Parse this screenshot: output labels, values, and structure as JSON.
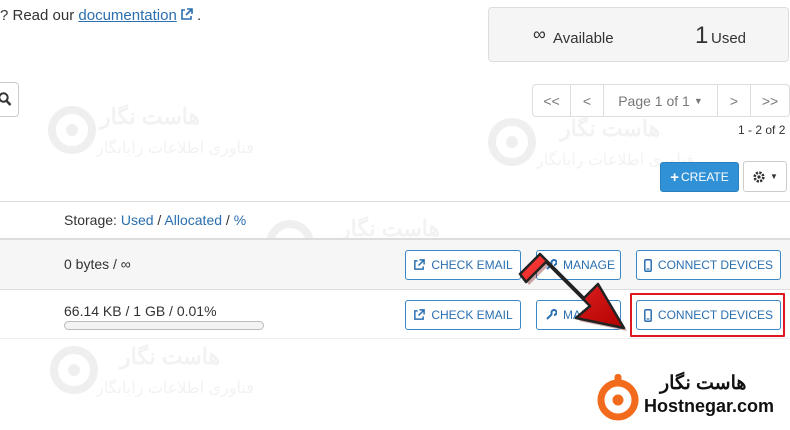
{
  "help": {
    "prefix": "? Read our ",
    "link": "documentation",
    "suffix": " ."
  },
  "stats": {
    "available_symbol": "∞",
    "available_label": "Available",
    "used_count": "1",
    "used_label": "Used"
  },
  "pagination": {
    "first": "<<",
    "prev": "<",
    "page_label": "Page 1 of 1",
    "next": ">",
    "last": ">>",
    "range": "1 - 2 of 2"
  },
  "toolbar": {
    "create_label": "CREATE"
  },
  "table": {
    "storage_label": "Storage: ",
    "used": "Used",
    "sep1": " / ",
    "allocated": "Allocated",
    "sep2": " / ",
    "percent": "%"
  },
  "rows": [
    {
      "usage": "0 bytes / ∞",
      "check_email": "CHECK EMAIL",
      "manage": "MANAGE",
      "connect_devices": "CONNECT DEVICES"
    },
    {
      "usage": "66.14 KB / 1 GB / 0.01%",
      "usage_fraction": 0.0001,
      "check_email": "CHECK EMAIL",
      "manage": "MANAGE",
      "connect_devices": "CONNECT DEVICES"
    }
  ],
  "watermark": {
    "name": "هاست نگار",
    "tagline": "فناوری اطلاعات رایانگار"
  },
  "logo": {
    "name_fa": "هاست نگار",
    "name_en": "Hostnegar.com"
  },
  "colors": {
    "link": "#2a6fb0",
    "primary": "#3091d6",
    "highlight": "#e0171f",
    "logo_accent": "#f26a1b"
  },
  "icons": [
    "search-icon",
    "external-link-icon",
    "plus-icon",
    "gear-icon",
    "caret-down-icon",
    "wrench-icon",
    "mobile-icon"
  ]
}
